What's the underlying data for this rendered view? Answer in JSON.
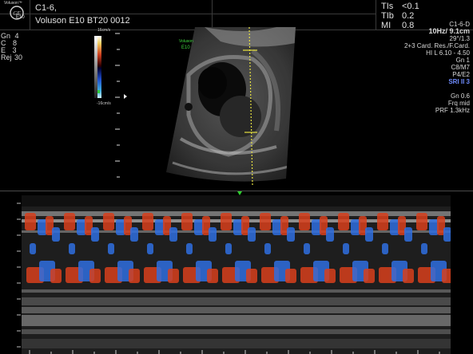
{
  "header": {
    "logo_name": "Voluson™",
    "logo_model": "E10",
    "probe": "C1-6,",
    "device": "Voluson E10 BT20 0012",
    "indices": [
      {
        "label": "TIs",
        "value": "<0.1"
      },
      {
        "label": "TIb",
        "value": "0.2"
      },
      {
        "label": "MI",
        "value": "0.8"
      }
    ]
  },
  "left_params": [
    {
      "label": "Gn",
      "value": "4"
    },
    {
      "label": "C",
      "value": "8"
    },
    {
      "label": "E",
      "value": "3"
    },
    {
      "label": "Rej",
      "value": "30"
    }
  ],
  "color_bar": {
    "top_label": "16cm/s",
    "bottom_label": "-16cm/s"
  },
  "right_params": {
    "probe_mode": "C1-6-D",
    "frame_depth": "10Hz/ 9.1cm",
    "angle": "29°/1.3",
    "preset": "2+3 Card. Res./F.Card.",
    "harmonic": "HI L  6.10 - 4.50",
    "gain": "Gn  1",
    "cmap": "C8/M7",
    "persist": "P4/E2",
    "sri": "SRI II 3",
    "color_gain": "Gn  0.6",
    "frq": "Frq mid",
    "prf": "PRF  1.3kHz"
  },
  "sector_logo": {
    "name": "Voluson",
    "model": "E10"
  },
  "colors": {
    "doppler_red": "#d8401c",
    "doppler_blue": "#2f6ee0",
    "marker_green": "#2fd02f",
    "cursor_yellow": "#e6e040"
  }
}
